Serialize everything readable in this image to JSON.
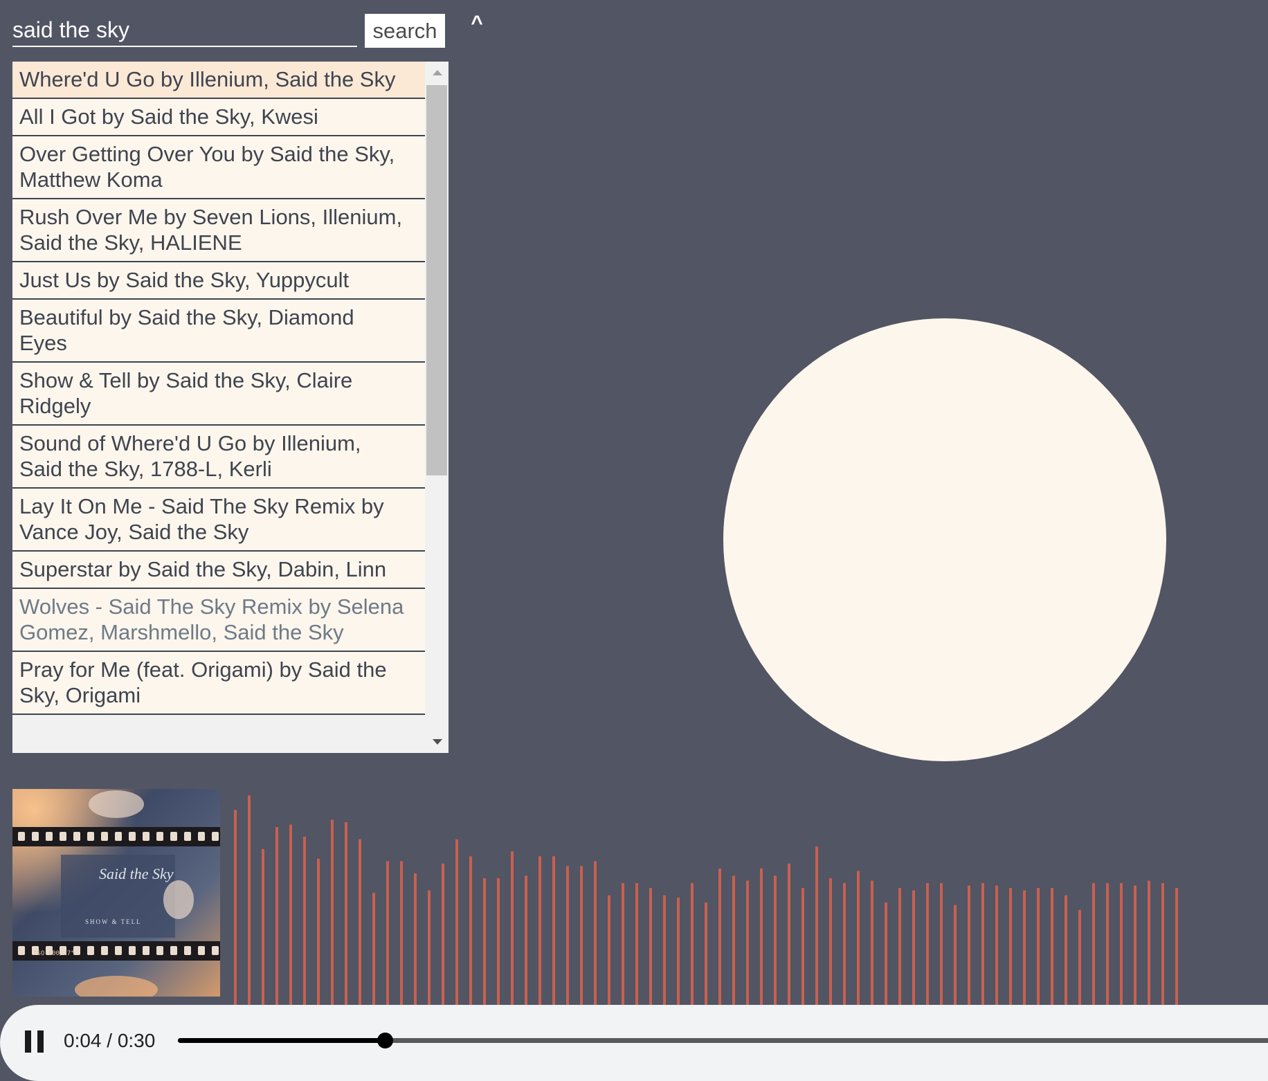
{
  "search": {
    "value": "said the sky",
    "button_label": "search",
    "collapse_label": "^"
  },
  "results": [
    {
      "lines": [
        "Where'd U Go by Illenium, Said the Sky"
      ],
      "state": "active"
    },
    {
      "lines": [
        "All I Got by Said the Sky, Kwesi"
      ],
      "state": "normal"
    },
    {
      "lines": [
        "Over Getting Over You by Said the Sky,",
        "Matthew Koma"
      ],
      "state": "normal"
    },
    {
      "lines": [
        "Rush Over Me by Seven Lions, Illenium,",
        "Said the Sky, HALIENE"
      ],
      "state": "normal"
    },
    {
      "lines": [
        "Just Us by Said the Sky, Yuppycult"
      ],
      "state": "normal"
    },
    {
      "lines": [
        "Beautiful by Said the Sky, Diamond",
        "Eyes"
      ],
      "state": "normal"
    },
    {
      "lines": [
        "Show & Tell by Said the Sky, Claire",
        "Ridgely"
      ],
      "state": "normal"
    },
    {
      "lines": [
        "Sound of Where'd U Go by Illenium,",
        "Said the Sky, 1788-L, Kerli"
      ],
      "state": "normal"
    },
    {
      "lines": [
        "Lay It On Me - Said The Sky Remix by",
        "Vance Joy, Said the Sky"
      ],
      "state": "normal"
    },
    {
      "lines": [
        "Superstar by Said the Sky, Dabin, Linn"
      ],
      "state": "normal"
    },
    {
      "lines": [
        "Wolves - Said The Sky Remix by Selena",
        "Gomez, Marshmello, Said the Sky"
      ],
      "state": "muted"
    },
    {
      "lines": [
        "Pray for Me (feat. Origami) by Said the",
        "Sky, Origami"
      ],
      "state": "normal"
    }
  ],
  "album_art": {
    "script_text": "Said the Sky",
    "caption": "SHOW & TELL",
    "film_text": "ISO 400/27°"
  },
  "visualizer": {
    "color": "#c9604f",
    "levels": [
      0.8,
      0.86,
      0.64,
      0.73,
      0.74,
      0.69,
      0.6,
      0.76,
      0.75,
      0.68,
      0.46,
      0.59,
      0.59,
      0.54,
      0.47,
      0.58,
      0.68,
      0.61,
      0.52,
      0.52,
      0.63,
      0.53,
      0.61,
      0.61,
      0.57,
      0.57,
      0.59,
      0.45,
      0.5,
      0.5,
      0.48,
      0.45,
      0.44,
      0.5,
      0.42,
      0.56,
      0.53,
      0.51,
      0.56,
      0.53,
      0.58,
      0.48,
      0.65,
      0.52,
      0.5,
      0.55,
      0.51,
      0.42,
      0.48,
      0.47,
      0.5,
      0.5,
      0.41,
      0.49,
      0.5,
      0.49,
      0.48,
      0.47,
      0.48,
      0.48,
      0.45,
      0.39,
      0.5,
      0.5,
      0.5,
      0.49,
      0.51,
      0.5,
      0.48
    ]
  },
  "player": {
    "time": "0:04 / 0:30",
    "progress": 0.1333
  },
  "colors": {
    "background": "#525563",
    "circle": "#fdf6ec",
    "list_item": "#fdf6ec",
    "active_item": "#fbe9d6"
  }
}
